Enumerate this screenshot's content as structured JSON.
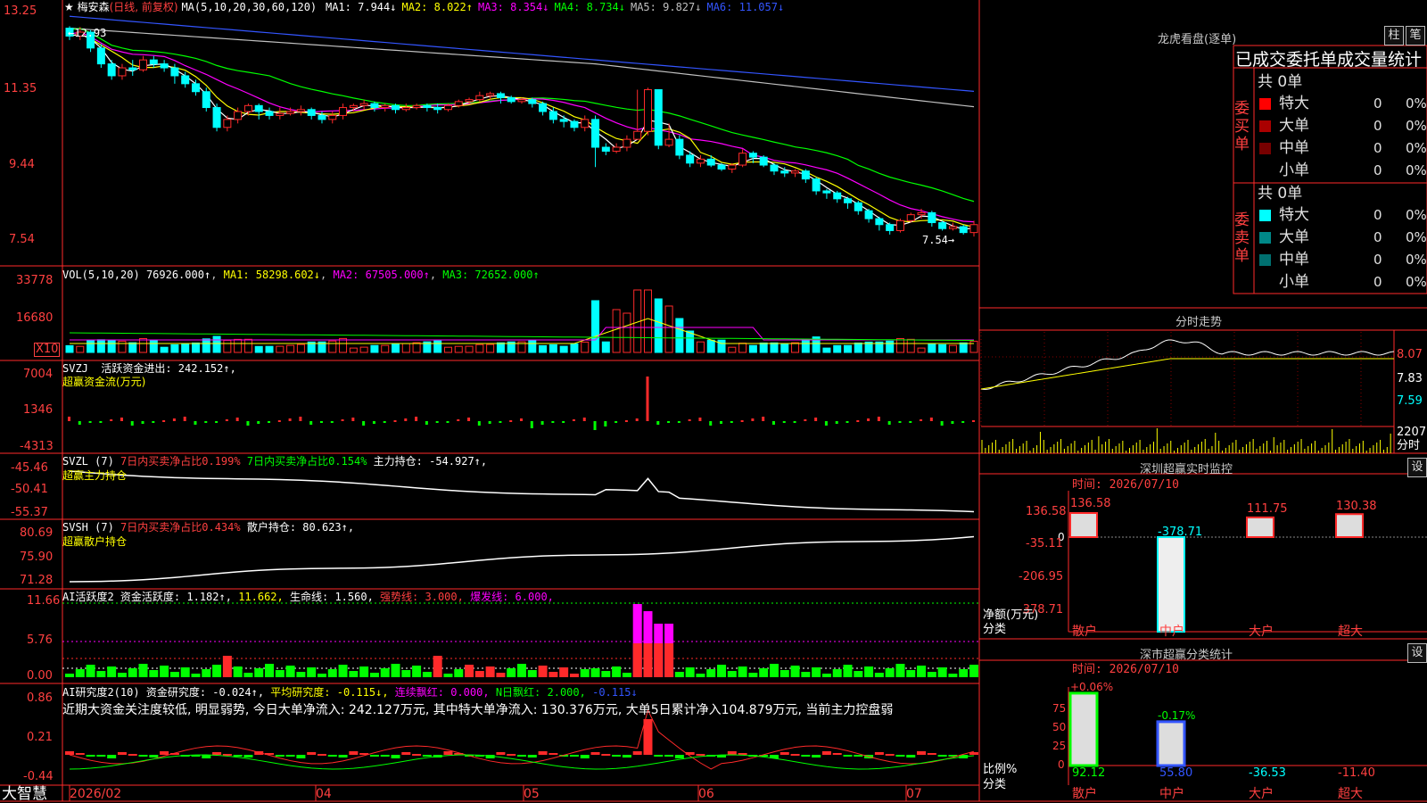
{
  "stock": {
    "star": "★",
    "name": "梅安森",
    "period": "(日线, 前复权)",
    "ma_label": "MA(5,10,20,30,60,120)"
  },
  "ma_values": [
    {
      "label": "MA1:",
      "value": "7.944↓",
      "color": "#ffffff"
    },
    {
      "label": "MA2:",
      "value": "8.022↑",
      "color": "#ffff00"
    },
    {
      "label": "MA3:",
      "value": "8.354↓",
      "color": "#ff00ff"
    },
    {
      "label": "MA4:",
      "value": "8.734↓",
      "color": "#00ff00"
    },
    {
      "label": "MA5:",
      "value": "9.827↓",
      "color": "#c0c0c0"
    },
    {
      "label": "MA6:",
      "value": "11.057↓",
      "color": "#3355ff"
    }
  ],
  "price_axis": [
    "13.25",
    "11.35",
    "9.44",
    "7.54"
  ],
  "price_annot": {
    "high": "12.93",
    "low": "7.54"
  },
  "vol": {
    "title": "VOL(5,10,20)",
    "value": "76926.000↑",
    "ma1": "MA1: 58298.602↓",
    "ma2": "MA2: 67505.000↑",
    "ma3": "MA3: 72652.000↑",
    "axis": [
      "33778",
      "16680"
    ],
    "unit": "X10"
  },
  "svzj": {
    "title": "SVZJ",
    "label": "活跃资金进出: 242.152↑,",
    "sub": "超赢资金流(万元)",
    "axis": [
      "7004",
      "1346",
      "-4313"
    ]
  },
  "svzl": {
    "title": "SVZL (7)",
    "t1": "7日内买卖净占比0.199%",
    "t2": "7日内买卖净占比0.154%",
    "t3": "主力持仓: -54.927↑,",
    "sub": "超赢主力持仓",
    "axis": [
      "-45.46",
      "-50.41",
      "-55.37"
    ]
  },
  "svsh": {
    "title": "SVSH (7)",
    "t1": "7日内买卖净占比0.434%",
    "t3": "散户持仓: 80.623↑,",
    "sub": "超赢散户持仓",
    "axis": [
      "80.69",
      "75.90",
      "71.28"
    ]
  },
  "ai1": {
    "title": "AI活跃度2",
    "t1": "资金活跃度: 1.182↑,",
    "t2": "11.662,",
    "t3": "生命线: 1.560,",
    "t4": "强势线: 3.000,",
    "t5": "爆发线: 6.000,",
    "axis": [
      "11.66",
      "5.76",
      "0.00"
    ]
  },
  "ai2": {
    "title": "AI研究度2(10)",
    "t1": "资金研究度: -0.024↑,",
    "t2": "平均研究度: -0.115↓,",
    "t3": "连续飘红: 0.000,",
    "t4": "N日飘红: 2.000,",
    "t5": "-0.115↓",
    "comment": "近期大资金关注度较低, 明显弱势, 今日大单净流入: 242.127万元, 其中特大单净流入: 130.376万元, 大单5日累计净入104.879万元, 当前主力控盘弱",
    "axis": [
      "0.86",
      "0.21",
      "-0.44"
    ]
  },
  "date_axis": [
    "2026/02",
    "04",
    "05",
    "06",
    "07"
  ],
  "brand": "大智慧",
  "right": {
    "lhkp_title": "龙虎看盘(逐单)",
    "btn1": "柱",
    "btn2": "笔",
    "tabs": "已成交委托单成交量统计",
    "buy_label": "委买单",
    "sell_label": "委卖单",
    "buy_total": "共 0单",
    "sell_total": "共 0单",
    "buy_rows": [
      {
        "name": "特大",
        "n": "0",
        "p": "0%",
        "color": "#ff0000"
      },
      {
        "name": "大单",
        "n": "0",
        "p": "0%",
        "color": "#aa0000"
      },
      {
        "name": "中单",
        "n": "0",
        "p": "0%",
        "color": "#770000"
      },
      {
        "name": "小单",
        "n": "0",
        "p": "0%",
        "color": "#000000"
      }
    ],
    "sell_rows": [
      {
        "name": "特大",
        "n": "0",
        "p": "0%",
        "color": "#00ffff"
      },
      {
        "name": "大单",
        "n": "0",
        "p": "0%",
        "color": "#008888"
      },
      {
        "name": "中单",
        "n": "0",
        "p": "0%",
        "color": "#007070"
      },
      {
        "name": "小单",
        "n": "0",
        "p": "0%",
        "color": "#000000"
      }
    ],
    "fs_title": "分时走势",
    "fs_axis": [
      "8.07",
      "7.83",
      "7.59",
      "2207"
    ],
    "fs_unit": "分时",
    "sz_title": "深圳超赢实时监控",
    "sz_btn": "设",
    "sz_time": "时间: 2026/07/10",
    "sz_axis": [
      "136.58",
      "0",
      "-35.11",
      "-206.95",
      "-378.71"
    ],
    "sz_ylabel": "净额(万元)",
    "sz_xlabel": "分类",
    "sz_bars": [
      {
        "cat": "散户",
        "value": "136.58"
      },
      {
        "cat": "中户",
        "value": "-378.71"
      },
      {
        "cat": "大户",
        "value": "111.75"
      },
      {
        "cat": "超大",
        "value": "130.38"
      }
    ],
    "ss_title": "深市超赢分类统计",
    "ss_btn": "设",
    "ss_time": "时间: 2026/07/10",
    "ss_axis": [
      "75",
      "50",
      "25",
      "0"
    ],
    "ss_ylabel": "比例%",
    "ss_xlabel": "分类",
    "ss_top": [
      "+0.06%",
      "-0.17%"
    ],
    "ss_vals": [
      "92.12",
      "55.80",
      "-36.53",
      "-11.40"
    ],
    "ss_cats": [
      "散户",
      "中户",
      "大户",
      "超大"
    ]
  },
  "chart_data": {
    "type": "candlestick",
    "title": "梅安森 (日线, 前复权)",
    "x_range": [
      "2026/02",
      "2026/07"
    ],
    "ylim": [
      7.54,
      13.25
    ],
    "candles": [
      [
        12.9,
        12.7,
        12.95,
        12.6
      ],
      [
        12.7,
        12.8,
        12.93,
        12.6
      ],
      [
        12.8,
        12.4,
        12.85,
        12.3
      ],
      [
        12.4,
        12.0,
        12.5,
        11.9
      ],
      [
        12.0,
        11.7,
        12.1,
        11.6
      ],
      [
        11.7,
        11.9,
        12.0,
        11.6
      ],
      [
        11.9,
        11.85,
        12.1,
        11.7
      ],
      [
        11.85,
        12.1,
        12.2,
        11.8
      ],
      [
        12.1,
        12.0,
        12.2,
        11.9
      ],
      [
        12.0,
        11.9,
        12.1,
        11.8
      ],
      [
        11.9,
        11.7,
        12.0,
        11.5
      ],
      [
        11.7,
        11.5,
        11.8,
        11.4
      ],
      [
        11.5,
        11.3,
        11.6,
        11.2
      ],
      [
        11.3,
        10.9,
        11.4,
        10.8
      ],
      [
        10.9,
        10.4,
        11.0,
        10.3
      ],
      [
        10.4,
        10.6,
        10.7,
        10.3
      ],
      [
        10.6,
        10.8,
        10.9,
        10.5
      ],
      [
        10.8,
        10.95,
        11.0,
        10.7
      ],
      [
        10.95,
        10.8,
        11.0,
        10.6
      ],
      [
        10.8,
        10.7,
        10.9,
        10.6
      ],
      [
        10.7,
        10.75,
        10.9,
        10.6
      ],
      [
        10.75,
        10.8,
        10.9,
        10.7
      ],
      [
        10.8,
        10.85,
        10.95,
        10.7
      ],
      [
        10.85,
        10.7,
        10.9,
        10.6
      ],
      [
        10.7,
        10.6,
        10.8,
        10.5
      ],
      [
        10.6,
        10.7,
        10.8,
        10.5
      ],
      [
        10.7,
        10.9,
        11.0,
        10.6
      ],
      [
        10.9,
        10.95,
        11.0,
        10.8
      ],
      [
        10.95,
        11.0,
        11.1,
        10.85
      ],
      [
        11.0,
        10.9,
        11.05,
        10.8
      ],
      [
        10.9,
        10.95,
        11.0,
        10.8
      ],
      [
        10.95,
        10.85,
        11.0,
        10.75
      ],
      [
        10.85,
        10.9,
        11.0,
        10.8
      ],
      [
        10.9,
        10.95,
        11.0,
        10.85
      ],
      [
        10.95,
        10.9,
        11.0,
        10.8
      ],
      [
        10.9,
        10.85,
        11.0,
        10.75
      ],
      [
        10.85,
        10.95,
        11.0,
        10.8
      ],
      [
        10.95,
        11.05,
        11.1,
        10.9
      ],
      [
        11.05,
        11.1,
        11.15,
        11.0
      ],
      [
        11.1,
        11.2,
        11.3,
        11.05
      ],
      [
        11.2,
        11.25,
        11.3,
        11.1
      ],
      [
        11.25,
        11.15,
        11.3,
        11.0
      ],
      [
        11.15,
        11.05,
        11.2,
        11.0
      ],
      [
        11.05,
        11.1,
        11.15,
        11.0
      ],
      [
        11.1,
        11.0,
        11.15,
        10.9
      ],
      [
        11.0,
        10.8,
        11.05,
        10.7
      ],
      [
        10.8,
        10.6,
        10.9,
        10.5
      ],
      [
        10.6,
        10.55,
        10.7,
        10.4
      ],
      [
        10.55,
        10.4,
        10.6,
        10.3
      ],
      [
        10.4,
        10.6,
        10.7,
        10.3
      ],
      [
        10.6,
        9.9,
        10.7,
        9.4
      ],
      [
        9.9,
        9.8,
        10.0,
        9.7
      ],
      [
        9.8,
        9.9,
        10.0,
        9.75
      ],
      [
        9.9,
        10.1,
        10.2,
        9.8
      ],
      [
        10.1,
        10.3,
        11.35,
        10.2
      ],
      [
        10.3,
        11.35,
        11.4,
        10.2
      ],
      [
        11.35,
        9.95,
        11.35,
        9.85
      ],
      [
        9.95,
        10.1,
        10.5,
        9.9
      ],
      [
        10.1,
        9.7,
        10.2,
        9.6
      ],
      [
        9.7,
        9.5,
        9.8,
        9.4
      ],
      [
        9.5,
        9.6,
        9.7,
        9.4
      ],
      [
        9.6,
        9.45,
        9.7,
        9.4
      ],
      [
        9.45,
        9.35,
        9.5,
        9.3
      ],
      [
        9.35,
        9.45,
        9.5,
        9.25
      ],
      [
        9.45,
        9.75,
        9.85,
        9.4
      ],
      [
        9.75,
        9.65,
        9.8,
        9.5
      ],
      [
        9.65,
        9.45,
        9.7,
        9.4
      ],
      [
        9.45,
        9.3,
        9.5,
        9.2
      ],
      [
        9.3,
        9.25,
        9.4,
        9.15
      ],
      [
        9.25,
        9.3,
        9.35,
        9.15
      ],
      [
        9.3,
        9.1,
        9.35,
        9.0
      ],
      [
        9.1,
        8.8,
        9.15,
        8.7
      ],
      [
        8.8,
        8.75,
        8.85,
        8.6
      ],
      [
        8.75,
        8.6,
        8.8,
        8.5
      ],
      [
        8.6,
        8.5,
        8.65,
        8.35
      ],
      [
        8.5,
        8.3,
        8.55,
        8.2
      ],
      [
        8.3,
        8.1,
        8.35,
        8.0
      ],
      [
        8.1,
        7.95,
        8.15,
        7.8
      ],
      [
        7.95,
        7.8,
        8.0,
        7.7
      ],
      [
        7.8,
        8.05,
        8.1,
        7.75
      ],
      [
        8.05,
        8.2,
        8.25,
        8.0
      ],
      [
        8.2,
        8.25,
        8.35,
        8.1
      ],
      [
        8.25,
        8.0,
        8.3,
        7.9
      ],
      [
        8.0,
        7.85,
        8.05,
        7.8
      ],
      [
        7.85,
        7.9,
        8.0,
        7.8
      ],
      [
        7.9,
        7.75,
        7.95,
        7.7
      ],
      [
        7.75,
        7.95,
        8.05,
        7.65
      ]
    ],
    "volume_axis": [
      "33778",
      "16680"
    ],
    "sz_realtime": {
      "categories": [
        "散户",
        "中户",
        "大户",
        "超大"
      ],
      "values": [
        136.58,
        -378.71,
        111.75,
        130.38
      ]
    },
    "ss_classify": {
      "categories": [
        "散户",
        "中户",
        "大户",
        "超大"
      ],
      "values": [
        92.12,
        55.8,
        -36.53,
        -11.4
      ]
    }
  }
}
